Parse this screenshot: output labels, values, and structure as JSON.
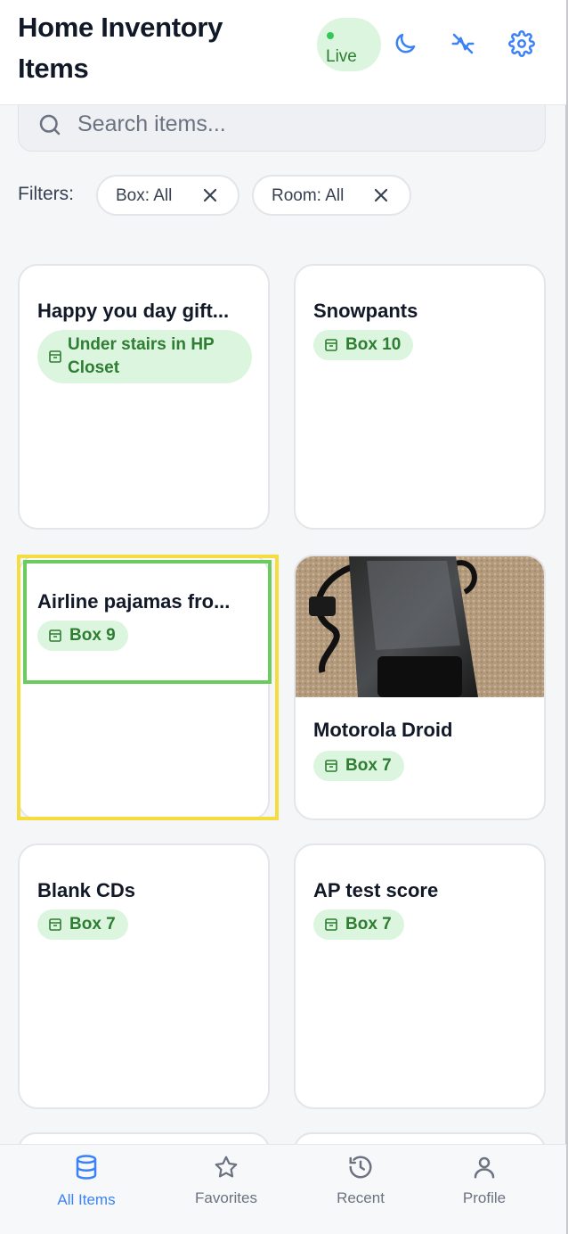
{
  "header": {
    "title": "Home Inventory Items",
    "live_label": "Live",
    "icons": [
      "moon-icon",
      "sync-off-icon",
      "gear-icon"
    ],
    "accent_color": "#3b82f6"
  },
  "search": {
    "placeholder": "Search items..."
  },
  "filters": {
    "label": "Filters:",
    "chips": [
      {
        "label": "Box: All"
      },
      {
        "label": "Room: All"
      }
    ]
  },
  "items": [
    {
      "title": "Happy you day gift...",
      "location": "Under stairs in HP Closet"
    },
    {
      "title": "Snowpants",
      "location": "Box 10"
    },
    {
      "title": "Airline pajamas fro...",
      "location": "Box 9"
    },
    {
      "title": "Motorola Droid",
      "location": "Box 7",
      "has_photo": true
    },
    {
      "title": "Blank CDs",
      "location": "Box 7"
    },
    {
      "title": "AP test score",
      "location": "Box 7"
    }
  ],
  "bottom_nav": [
    {
      "label": "All Items",
      "icon": "database-icon",
      "active": true
    },
    {
      "label": "Favorites",
      "icon": "star-icon",
      "active": false
    },
    {
      "label": "Recent",
      "icon": "history-icon",
      "active": false
    },
    {
      "label": "Profile",
      "icon": "user-icon",
      "active": false
    }
  ],
  "colors": {
    "badge_bg": "#dcf5df",
    "badge_text": "#2e7d32",
    "highlight_outer": "#f5dc3f",
    "highlight_inner": "#6ccb5f"
  }
}
